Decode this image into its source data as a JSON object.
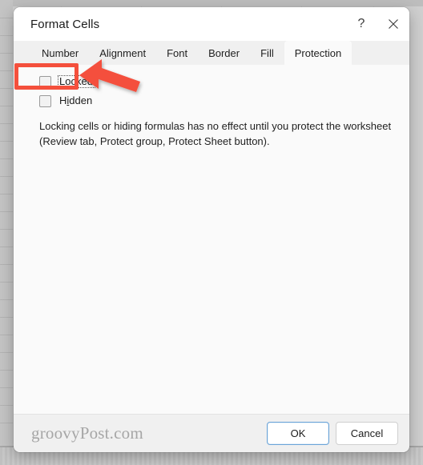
{
  "dialog": {
    "title": "Format Cells",
    "titlebar_buttons": [
      {
        "name": "help-button",
        "glyph": "?"
      },
      {
        "name": "close-button",
        "glyph": "✕"
      }
    ],
    "tabs": [
      {
        "label": "Number",
        "active": false
      },
      {
        "label": "Alignment",
        "active": false
      },
      {
        "label": "Font",
        "active": false
      },
      {
        "label": "Border",
        "active": false
      },
      {
        "label": "Fill",
        "active": false
      },
      {
        "label": "Protection",
        "active": true
      }
    ],
    "protection": {
      "locked": {
        "label": "Locked",
        "accel": "L",
        "rest": "ocked",
        "checked": false,
        "focused": true
      },
      "hidden": {
        "label": "Hidden",
        "accel_prefix": "H",
        "accel": "i",
        "rest": "dden",
        "checked": false,
        "focused": false
      },
      "description": "Locking cells or hiding formulas has no effect until you protect the worksheet (Review tab, Protect group, Protect Sheet button)."
    },
    "footer": {
      "watermark": "groovyPost.com",
      "ok_label": "OK",
      "cancel_label": "Cancel"
    }
  },
  "annotation": {
    "highlight_color": "#f4503c",
    "arrow_color": "#f4503c",
    "target": "Locked"
  }
}
